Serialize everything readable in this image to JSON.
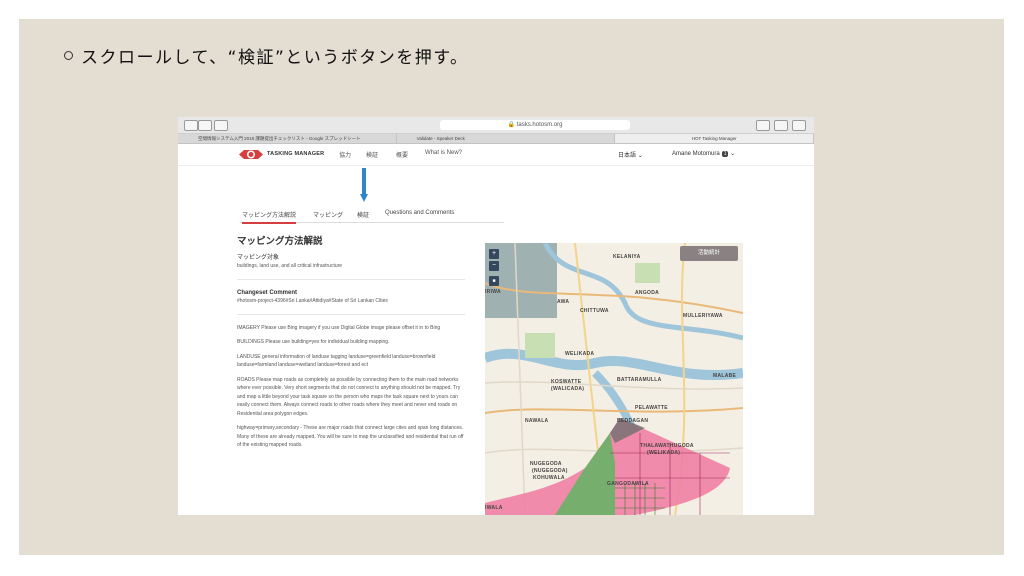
{
  "slide": {
    "instruction": "スクロールして、“検証”というボタンを押す。"
  },
  "browser": {
    "url": "tasks.hotosm.org",
    "tabs": [
      "空間情報システム入門 2018 課題提出チェックリスト - Google スプレッドシート",
      "Validate - Speaker Deck",
      "HOT Tasking Manager"
    ]
  },
  "navbar": {
    "brand": "TASKING MANAGER",
    "links": [
      "協力",
      "検証",
      "概要",
      "What is New?"
    ],
    "language": "日本語",
    "user": "Amane Motomura",
    "user_badge": "1"
  },
  "subtabs": [
    "マッピング方法解説",
    "マッピング",
    "検証",
    "Questions and Comments"
  ],
  "instructions": {
    "title": "マッピング方法解説",
    "target_label": "マッピング対象",
    "target_value": "buildings, land use, and all critical infrastructure",
    "changeset_title": "Changeset Comment",
    "changeset_value": "#hotosm-project-4396#Sri Lanka#Attidiya#State of Sri Lankan Cities",
    "paragraphs": [
      "IMAGERY Please use Bing imagery if you use Digital Globe image please offset it in to Bing",
      "BUILDINGS Please use building=yes for individual building mapping.",
      "LANDUSE general information of landuse tagging landuse=greenfield landuse=brownfield landuse=farmland landuse=wetland landuse=forest and ect",
      "ROADS Please map roads as completely as possible by connecting them to the main road networks where ever possible. Very short segments that do not connect to anything should not be mapped. Try and map a little beyond your task square so the person who maps the task square next to yours can easily connect them. Always connect roads to other roads where they meet and never end roads on Residential area polygon edges.",
      "highway=primary,secondary - These are major roads that connect large cites and span long distances. Many of these are already mapped. You will be sure to map the unclassified and residential that run off of the existing mapped roads."
    ]
  },
  "map": {
    "zoom_in": "+",
    "zoom_out": "−",
    "layers": "■",
    "stats_button": "活動統計",
    "places": [
      "KELANIYA",
      "IRIWA",
      "AWA",
      "ANGODA",
      "MULLERIYAWA",
      "CHITTUWA",
      "WELIKADA",
      "KOSWATTE",
      "(WALICADA)",
      "BATTARAMULLA",
      "MALABE",
      "PELAWATTE",
      "NAWALA",
      "BEDDAGAN",
      "THALAWATHUGODA",
      "(WELIKADA)",
      "NUGEGODA",
      "(NUGEGODA)",
      "GANGODAWILA",
      "KOHUWALA",
      "IWALA"
    ]
  }
}
